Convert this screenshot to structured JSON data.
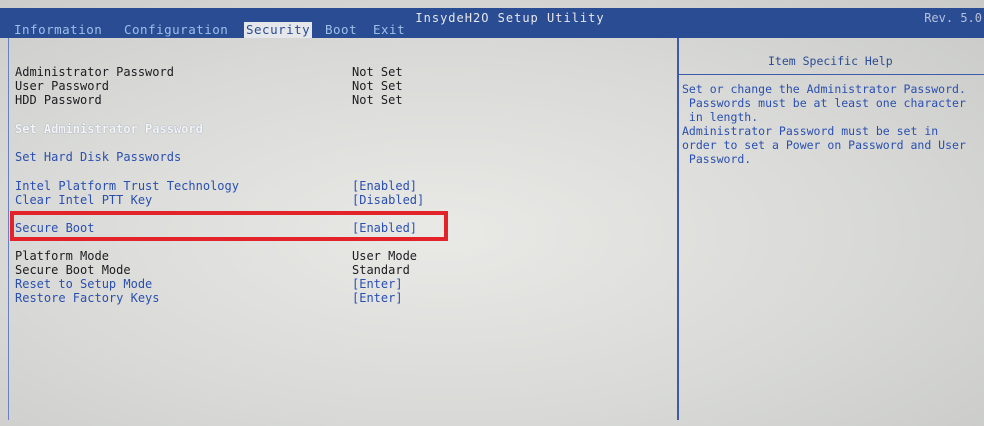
{
  "header": {
    "utility_title": "InsydeH2O Setup Utility",
    "revision": "Rev. 5.0"
  },
  "menu_tabs": [
    {
      "label": "Information",
      "active": false
    },
    {
      "label": "Configuration",
      "active": false
    },
    {
      "label": "Security",
      "active": true
    },
    {
      "label": "Boot",
      "active": false
    },
    {
      "label": "Exit",
      "active": false
    }
  ],
  "security_items": [
    {
      "label": "Administrator Password",
      "value": "Not Set"
    },
    {
      "label": "User Password",
      "value": "Not Set"
    },
    {
      "label": "HDD Password",
      "value": "Not Set"
    },
    {
      "label": "Set Administrator Password",
      "value": ""
    },
    {
      "label": "Set Hard Disk Passwords",
      "value": ""
    },
    {
      "label": "Intel Platform Trust Technology",
      "value": "[Enabled]"
    },
    {
      "label": "Clear Intel PTT Key",
      "value": "[Disabled]"
    },
    {
      "label": "Secure Boot",
      "value": "[Enabled]"
    },
    {
      "label": "Platform Mode",
      "value": "User Mode"
    },
    {
      "label": "Secure Boot Mode",
      "value": "Standard"
    },
    {
      "label": "Reset to Setup Mode",
      "value": "[Enter]"
    },
    {
      "label": "Restore Factory Keys",
      "value": "[Enter]"
    }
  ],
  "help_panel": {
    "title": "Item Specific Help",
    "text": "Set or change the Administrator Password.\n Passwords must be at least one character\n in length.\nAdministrator Password must be set in\norder to set a Power on Password and User\n Password."
  },
  "colors": {
    "title_bar": "#2a4c93",
    "link_text": "#2a4fb0",
    "highlight_box": "#e2242a"
  }
}
